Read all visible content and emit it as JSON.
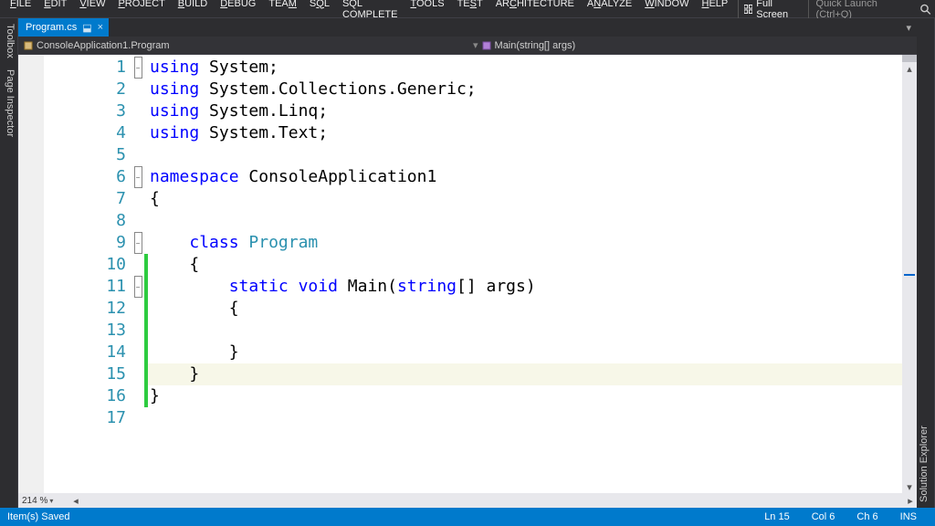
{
  "menu": {
    "items": [
      {
        "label": "FILE",
        "mnem": 0
      },
      {
        "label": "EDIT",
        "mnem": 0
      },
      {
        "label": "VIEW",
        "mnem": 0
      },
      {
        "label": "PROJECT",
        "mnem": 0
      },
      {
        "label": "BUILD",
        "mnem": 0
      },
      {
        "label": "DEBUG",
        "mnem": 0
      },
      {
        "label": "TEAM",
        "mnem": 3
      },
      {
        "label": "SQL",
        "mnem": 1
      },
      {
        "label": "SQL COMPLETE",
        "mnem": -1
      },
      {
        "label": "TOOLS",
        "mnem": 0
      },
      {
        "label": "TEST",
        "mnem": 2
      },
      {
        "label": "ARCHITECTURE",
        "mnem": 2
      },
      {
        "label": "ANALYZE",
        "mnem": 1
      },
      {
        "label": "WINDOW",
        "mnem": 0
      },
      {
        "label": "HELP",
        "mnem": 0
      }
    ],
    "full_screen": "Full Screen",
    "quick_launch": "Quick Launch (Ctrl+Q)"
  },
  "side_tabs": {
    "left": [
      "Toolbox",
      "Page Inspector"
    ],
    "right": [
      "Solution Explorer"
    ]
  },
  "tab": {
    "label": "Program.cs",
    "dirty_close": "×"
  },
  "navbar": {
    "left": "ConsoleApplication1.Program",
    "right": "Main(string[] args)"
  },
  "zoom": "214 %",
  "status": {
    "left": "Item(s) Saved",
    "ln": "Ln 15",
    "col": "Col 6",
    "ch": "Ch 6",
    "ins": "INS"
  },
  "code": {
    "total_lines": 17,
    "highlighted_line": 15,
    "lines": [
      {
        "n": 1,
        "outline": "-",
        "change": false,
        "tokens": [
          [
            "kw",
            "using"
          ],
          [
            "",
            " "
          ],
          [
            "",
            "System;"
          ]
        ]
      },
      {
        "n": 2,
        "outline": "",
        "change": false,
        "tokens": [
          [
            "kw",
            "using"
          ],
          [
            "",
            " "
          ],
          [
            "",
            "System.Collections.Generic;"
          ]
        ]
      },
      {
        "n": 3,
        "outline": "",
        "change": false,
        "tokens": [
          [
            "kw",
            "using"
          ],
          [
            "",
            " "
          ],
          [
            "",
            "System.Linq;"
          ]
        ]
      },
      {
        "n": 4,
        "outline": "",
        "change": false,
        "tokens": [
          [
            "kw",
            "using"
          ],
          [
            "",
            " "
          ],
          [
            "",
            "System.Text;"
          ]
        ]
      },
      {
        "n": 5,
        "outline": "",
        "change": false,
        "tokens": []
      },
      {
        "n": 6,
        "outline": "-",
        "change": false,
        "tokens": [
          [
            "kw",
            "namespace"
          ],
          [
            "",
            " "
          ],
          [
            "",
            "ConsoleApplication1"
          ]
        ]
      },
      {
        "n": 7,
        "outline": "",
        "change": false,
        "tokens": [
          [
            "",
            "{"
          ]
        ]
      },
      {
        "n": 8,
        "outline": "",
        "change": false,
        "tokens": []
      },
      {
        "n": 9,
        "outline": "-",
        "change": false,
        "tokens": [
          [
            "",
            "    "
          ],
          [
            "kw",
            "class"
          ],
          [
            "",
            " "
          ],
          [
            "typ",
            "Program"
          ]
        ]
      },
      {
        "n": 10,
        "outline": "",
        "change": true,
        "tokens": [
          [
            "",
            "    {"
          ]
        ]
      },
      {
        "n": 11,
        "outline": "-",
        "change": true,
        "tokens": [
          [
            "",
            "        "
          ],
          [
            "kw",
            "static"
          ],
          [
            "",
            " "
          ],
          [
            "kw",
            "void"
          ],
          [
            "",
            " "
          ],
          [
            "",
            "Main("
          ],
          [
            "kw",
            "string"
          ],
          [
            "",
            "[] args)"
          ]
        ]
      },
      {
        "n": 12,
        "outline": "",
        "change": true,
        "tokens": [
          [
            "",
            "        {"
          ]
        ]
      },
      {
        "n": 13,
        "outline": "",
        "change": true,
        "tokens": []
      },
      {
        "n": 14,
        "outline": "",
        "change": true,
        "tokens": [
          [
            "",
            "        }"
          ]
        ]
      },
      {
        "n": 15,
        "outline": "",
        "change": true,
        "tokens": [
          [
            "",
            "    }"
          ]
        ]
      },
      {
        "n": 16,
        "outline": "",
        "change": true,
        "tokens": [
          [
            "",
            "}"
          ]
        ]
      },
      {
        "n": 17,
        "outline": "",
        "change": false,
        "tokens": []
      }
    ]
  }
}
